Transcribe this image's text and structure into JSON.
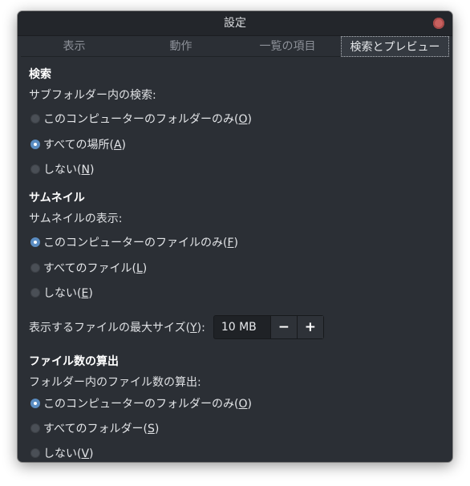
{
  "window": {
    "title": "設定"
  },
  "tabs": [
    {
      "label": "表示"
    },
    {
      "label": "動作"
    },
    {
      "label": "一覧の項目"
    },
    {
      "label": "検索とプレビュー",
      "active": true
    }
  ],
  "search": {
    "title": "検索",
    "label": "サブフォルダー内の検索:",
    "options": [
      {
        "text": "このコンピューターのフォルダーのみ",
        "key": "O",
        "checked": false
      },
      {
        "text": "すべての場所",
        "key": "A",
        "checked": true
      },
      {
        "text": "しない",
        "key": "N",
        "checked": false
      }
    ]
  },
  "thumbnails": {
    "title": "サムネイル",
    "label": "サムネイルの表示:",
    "options": [
      {
        "text": "このコンピューターのファイルのみ",
        "key": "F",
        "checked": true
      },
      {
        "text": "すべてのファイル",
        "key": "L",
        "checked": false
      },
      {
        "text": "しない",
        "key": "E",
        "checked": false
      }
    ],
    "max_size_label": "表示するファイルの最大サイズ",
    "max_size_key": "Y",
    "max_size_suffix": ":",
    "max_size_value": "10 MB",
    "decrement": "−",
    "increment": "+"
  },
  "file_count": {
    "title": "ファイル数の算出",
    "label": "フォルダー内のファイル数の算出:",
    "options": [
      {
        "text": "このコンピューターのフォルダーのみ",
        "key": "O",
        "checked": true
      },
      {
        "text": "すべてのフォルダー",
        "key": "S",
        "checked": false
      },
      {
        "text": "しない",
        "key": "V",
        "checked": false
      }
    ]
  },
  "colors": {
    "accent": "#5b8dc2",
    "window_bg": "#2b2f35",
    "close": "#c7615f"
  }
}
